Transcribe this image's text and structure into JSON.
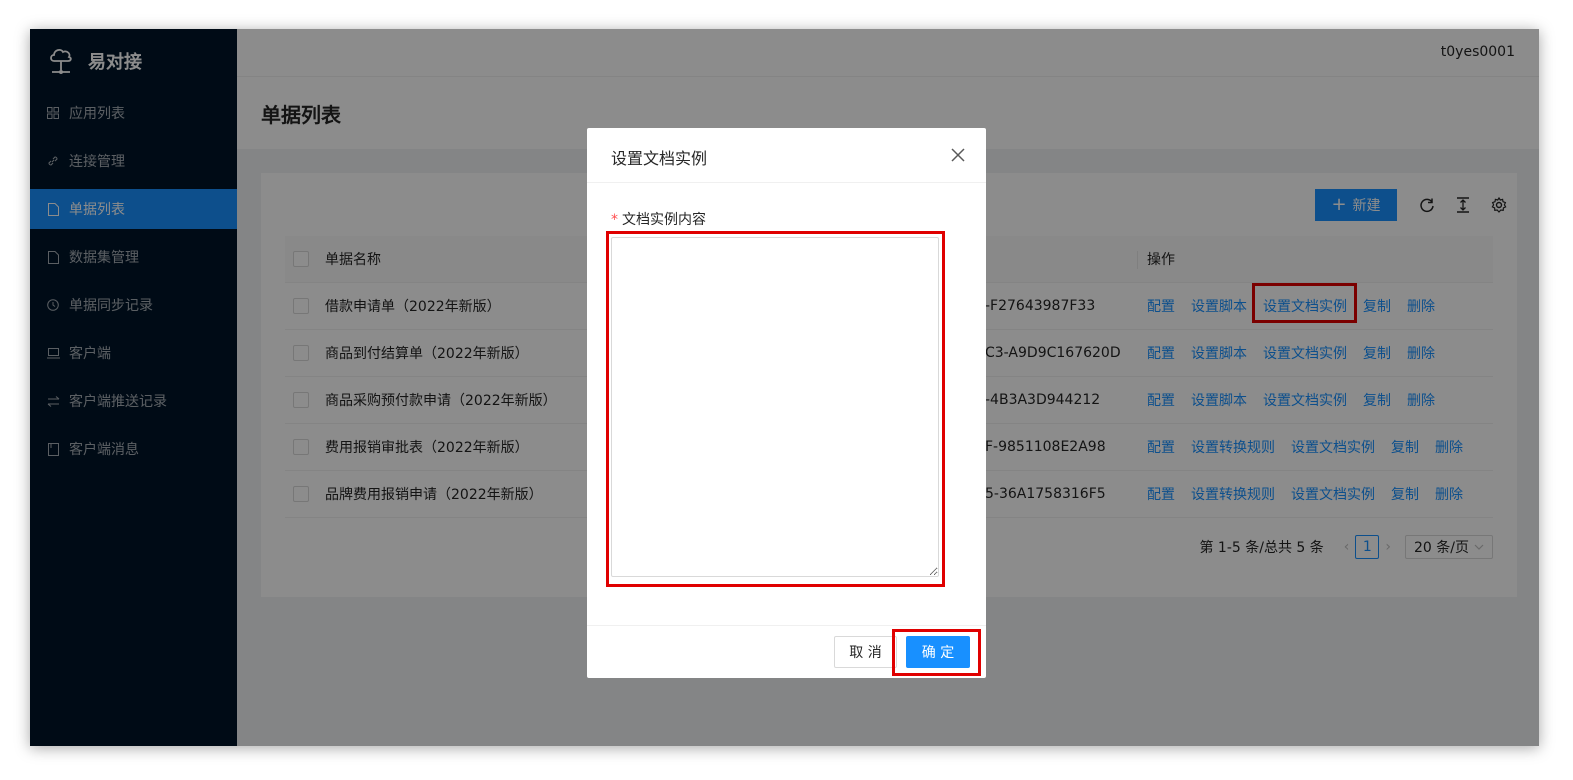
{
  "app": {
    "name": "易对接"
  },
  "header": {
    "user": "t0yes0001"
  },
  "sidebar": {
    "items": [
      {
        "label": "应用列表",
        "icon": "grid-icon"
      },
      {
        "label": "连接管理",
        "icon": "link-icon"
      },
      {
        "label": "单据列表",
        "icon": "file-icon",
        "active": true
      },
      {
        "label": "数据集管理",
        "icon": "file-icon"
      },
      {
        "label": "单据同步记录",
        "icon": "clock-icon"
      },
      {
        "label": "客户端",
        "icon": "laptop-icon"
      },
      {
        "label": "客户端推送记录",
        "icon": "swap-icon"
      },
      {
        "label": "客户端消息",
        "icon": "file-icon"
      }
    ]
  },
  "page": {
    "title": "单据列表"
  },
  "toolbar": {
    "new_label": "新建"
  },
  "table": {
    "headers": {
      "name": "单据名称",
      "ops": "操作"
    },
    "rows": [
      {
        "name": "借款申请单（2022年新版）",
        "id": "-F27643987F33",
        "ops": [
          "配置",
          "设置脚本",
          "设置文档实例",
          "复制",
          "删除"
        ]
      },
      {
        "name": "商品到付结算单（2022年新版）",
        "id": "C3-A9D9C167620D",
        "ops": [
          "配置",
          "设置脚本",
          "设置文档实例",
          "复制",
          "删除"
        ]
      },
      {
        "name": "商品采购预付款申请（2022年新版）",
        "id": "-4B3A3D944212",
        "ops": [
          "配置",
          "设置脚本",
          "设置文档实例",
          "复制",
          "删除"
        ]
      },
      {
        "name": "费用报销审批表（2022年新版）",
        "id": "F-9851108E2A98",
        "ops": [
          "配置",
          "设置转换规则",
          "设置文档实例",
          "复制",
          "删除"
        ]
      },
      {
        "name": "品牌费用报销申请（2022年新版）",
        "id": "5-36A1758316F5",
        "ops": [
          "配置",
          "设置转换规则",
          "设置文档实例",
          "复制",
          "删除"
        ]
      }
    ]
  },
  "pagination": {
    "total": "第 1-5 条/总共 5 条",
    "page": "1",
    "size": "20 条/页"
  },
  "modal": {
    "title": "设置文档实例",
    "field_label": "文档实例内容",
    "textarea_value": "",
    "cancel_label": "取 消",
    "ok_label": "确 定"
  },
  "colors": {
    "primary": "#1890ff",
    "sidebar_bg": "#001529",
    "highlight": "#e00000"
  }
}
